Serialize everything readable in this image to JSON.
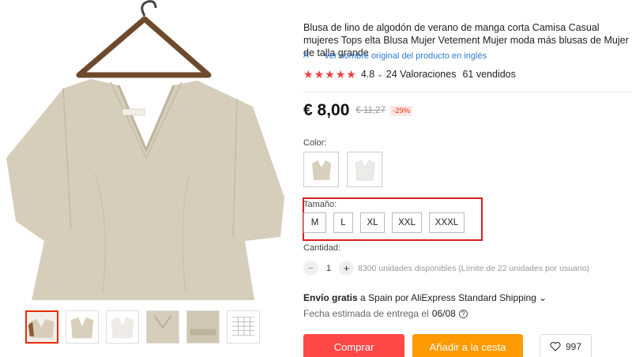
{
  "product": {
    "title": "Blusa de lino de algodón de verano de manga corta Camisa Casual mujeres Tops elta Blusa Mujer Vetement Mujer moda más blusas de Mujer de talla grande",
    "original_link": "Ver nombre original del producto en inglés",
    "translate_icon": "A",
    "rating": "4.8",
    "reviews": "24 Valoraciones",
    "sold": "61 vendidos",
    "star_count": 5
  },
  "price": {
    "current": "€ 8,00",
    "old": "€ 11,27",
    "discount": "-29%"
  },
  "color": {
    "label": "Color:",
    "options": [
      "beige",
      "white"
    ],
    "swatches": {
      "beige": "#d8d0bd",
      "white": "#f2f0ec"
    }
  },
  "size": {
    "label": "Tamaño:",
    "options": [
      "M",
      "L",
      "XL",
      "XXL",
      "XXXL"
    ]
  },
  "quantity": {
    "label": "Cantidad:",
    "minus": "−",
    "value": "1",
    "plus": "+",
    "available": "8300 unidades disponibles (Límite de 22 unidades por usuario)"
  },
  "shipping": {
    "free": "Envío gratis",
    "rest": " a Spain por AliExpress Standard Shipping ",
    "chevron": "⌄",
    "delivery_label": "Fecha estimada de entrega el",
    "delivery_date": "06/08",
    "help": "?"
  },
  "buttons": {
    "buy": "Comprar",
    "cart": "Añadir a la cesta",
    "wish_count": "997"
  },
  "colors": {
    "accent": "#ff4747",
    "cart": "#ff9a00",
    "highlight": "#d81e1e",
    "link": "#2d7bd4",
    "shirt": "#d6cebb"
  }
}
